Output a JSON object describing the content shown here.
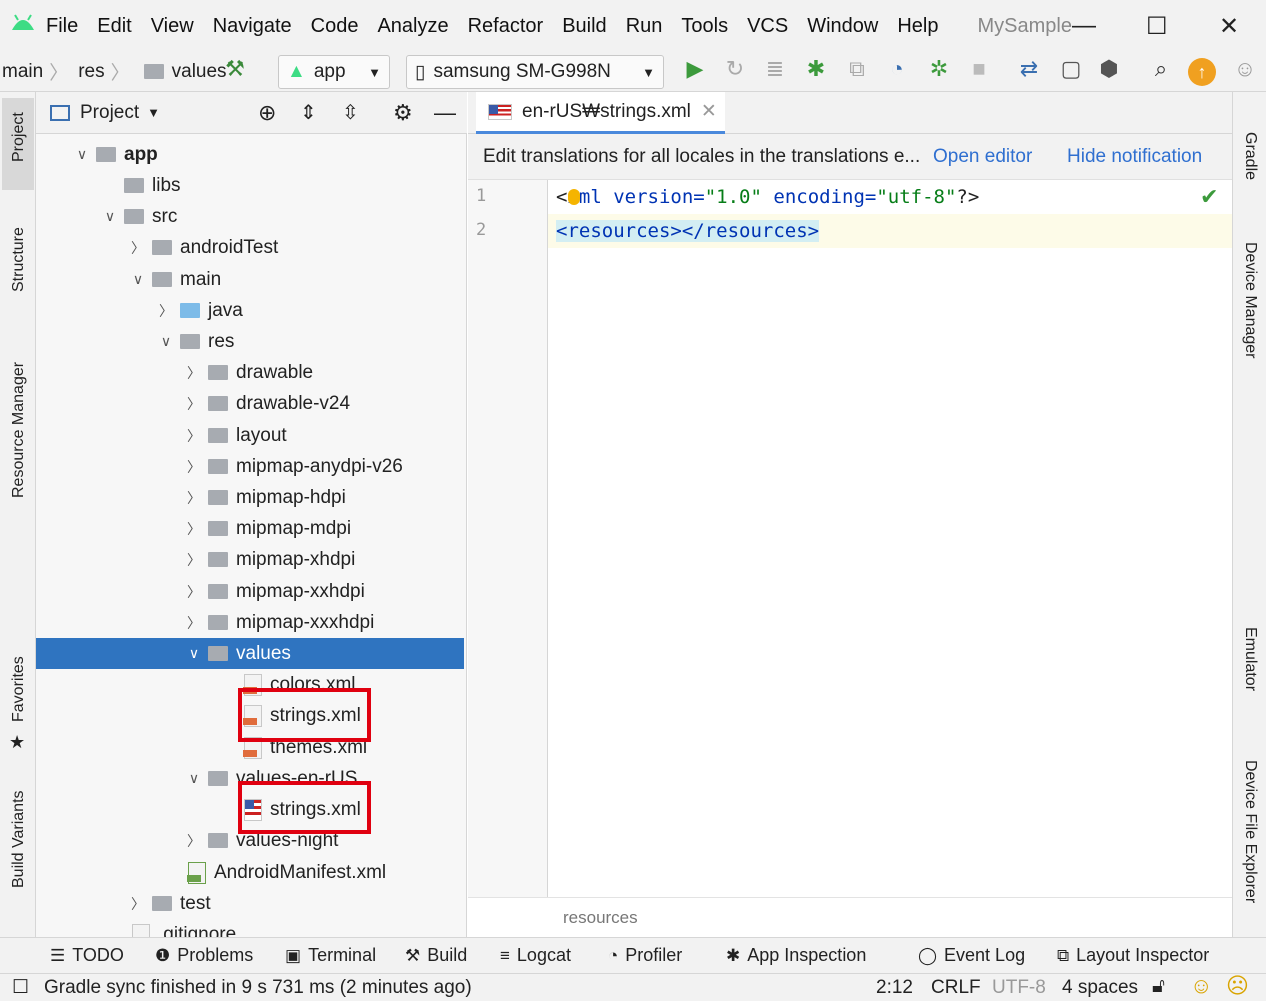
{
  "menubar": {
    "items": [
      "File",
      "Edit",
      "View",
      "Navigate",
      "Code",
      "Analyze",
      "Refactor",
      "Build",
      "Run",
      "Tools",
      "VCS",
      "Window",
      "Help"
    ],
    "app_title": "MySample",
    "minimize": "—",
    "maximize": "☐",
    "close": "✕"
  },
  "navbar": {
    "breadcrumbs": [
      "main",
      "res",
      "values"
    ],
    "run_config": "app",
    "device": "samsung SM-G998N"
  },
  "project_panel": {
    "title": "Project",
    "tree": [
      {
        "label": "app",
        "bold": true
      },
      {
        "label": "libs"
      },
      {
        "label": "src"
      },
      {
        "label": "androidTest"
      },
      {
        "label": "main"
      },
      {
        "label": "java"
      },
      {
        "label": "res"
      },
      {
        "label": "drawable"
      },
      {
        "label": "drawable-v24"
      },
      {
        "label": "layout"
      },
      {
        "label": "mipmap-anydpi-v26"
      },
      {
        "label": "mipmap-hdpi"
      },
      {
        "label": "mipmap-mdpi"
      },
      {
        "label": "mipmap-xhdpi"
      },
      {
        "label": "mipmap-xxhdpi"
      },
      {
        "label": "mipmap-xxxhdpi"
      },
      {
        "label": "values",
        "selected": true
      },
      {
        "label": "colors.xml"
      },
      {
        "label": "strings.xml"
      },
      {
        "label": "themes.xml"
      },
      {
        "label": "values-en-rUS"
      },
      {
        "label": "strings.xml"
      },
      {
        "label": "values-night"
      },
      {
        "label": "AndroidManifest.xml"
      },
      {
        "label": "test"
      },
      {
        "label": ".gitignore"
      }
    ]
  },
  "left_tool_tabs": [
    "Project",
    "Structure",
    "Resource Manager",
    "Favorites",
    "Build Variants"
  ],
  "right_tool_tabs": [
    "Gradle",
    "Device Manager",
    "Emulator",
    "Device File Explorer"
  ],
  "editor": {
    "tab_label": "en-rUS₩strings.xml",
    "notification": {
      "message": "Edit translations for all locales in the translations e...",
      "open_editor": "Open editor",
      "hide_notification": "Hide notification"
    },
    "line_numbers": [
      "1",
      "2"
    ],
    "lines": [
      {
        "p1": "<",
        "p2": "xml",
        "p3": " version=",
        "p4": "\"1.0\"",
        "p5": " encoding=",
        "p6": "\"utf-8\"",
        "p7": "?>"
      },
      {
        "p1": "<resources></resources>"
      }
    ],
    "breadcrumb": "resources"
  },
  "tool_windows": [
    "TODO",
    "Problems",
    "Terminal",
    "Build",
    "Logcat",
    "Profiler",
    "App Inspection",
    "Event Log",
    "Layout Inspector"
  ],
  "status_bar": {
    "message": "Gradle sync finished in 9 s 731 ms (2 minutes ago)",
    "position": "2:12",
    "line_sep": "CRLF",
    "encoding": "UTF-8",
    "indent": "4 spaces"
  },
  "colors": {
    "selection": "#2f74c0",
    "highlight_box": "#e00010",
    "link": "#2f6fd0"
  }
}
